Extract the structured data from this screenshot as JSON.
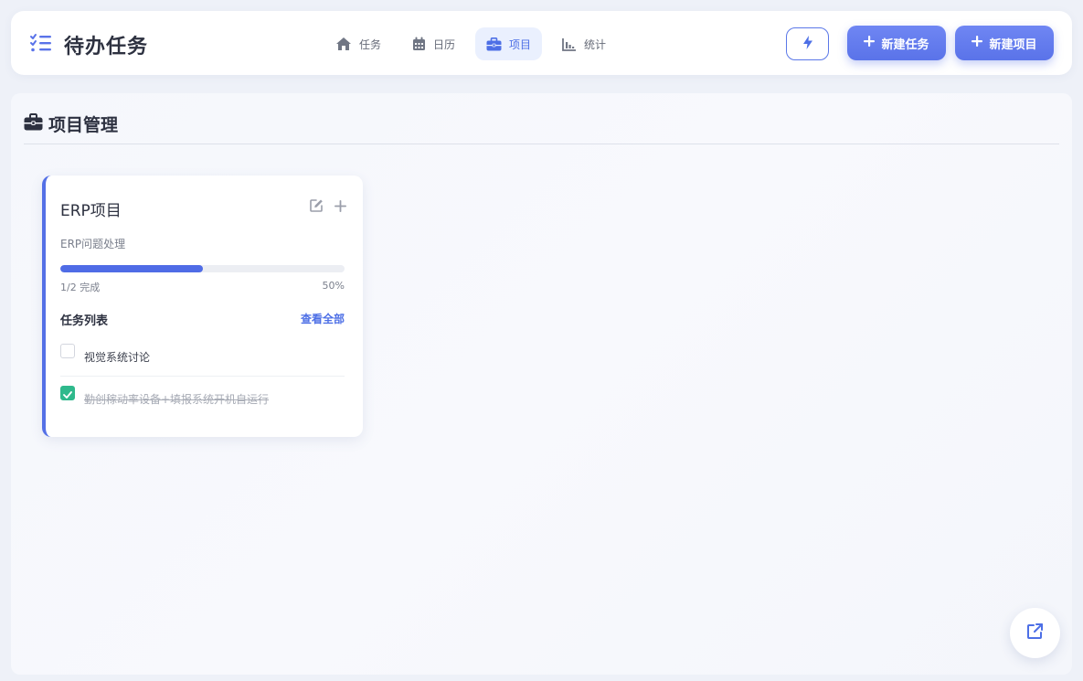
{
  "app": {
    "title": "待办任务",
    "logo_icon": "task-list-icon",
    "accent_color": "#5a73e9"
  },
  "nav": {
    "items": [
      {
        "label": "任务",
        "icon": "home-icon",
        "active": false
      },
      {
        "label": "日历",
        "icon": "calendar-icon",
        "active": false
      },
      {
        "label": "项目",
        "icon": "briefcase-icon",
        "active": true
      },
      {
        "label": "统计",
        "icon": "bar-chart-icon",
        "active": false
      }
    ]
  },
  "toolbar": {
    "quick_icon": "bolt-icon",
    "new_task_label": "新建任务",
    "new_project_label": "新建项目"
  },
  "main": {
    "section_title": "项目管理",
    "section_icon": "briefcase-icon"
  },
  "project_card": {
    "name": "ERP项目",
    "description": "ERP问题处理",
    "progress_fraction": 0.5,
    "progress_count_text": "1/2 完成",
    "progress_percent_text": "50%",
    "tasks_heading": "任务列表",
    "view_all_label": "查看全部",
    "tasks": [
      {
        "text": "视觉系统讨论",
        "done": false
      },
      {
        "text": "勤创稼动率设备+填报系统开机自运行",
        "done": true
      }
    ],
    "accent_color": "#5470e6"
  },
  "fab": {
    "icon": "external-link-icon"
  }
}
